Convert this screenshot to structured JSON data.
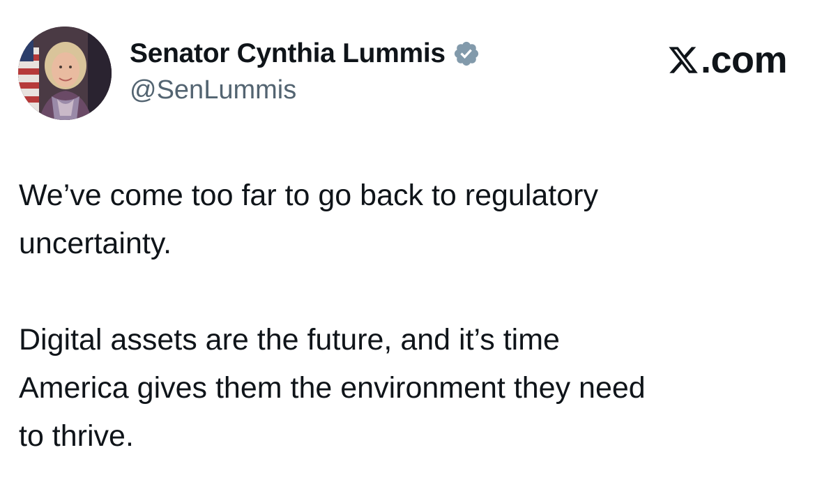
{
  "author": {
    "display_name": "Senator Cynthia Lummis",
    "handle": "@SenLummis",
    "verified": true,
    "verified_badge_color": "#829aab"
  },
  "brand": {
    "icon": "x-logo-icon",
    "text": ".com"
  },
  "tweet": {
    "paragraphs": [
      "We’ve come too far to go back to regulatory\nuncertainty.",
      "Digital assets are the future, and it’s time\nAmerica gives them the environment they need\nto thrive."
    ]
  },
  "colors": {
    "text": "#0f1419",
    "secondary": "#536471",
    "background": "#ffffff"
  }
}
